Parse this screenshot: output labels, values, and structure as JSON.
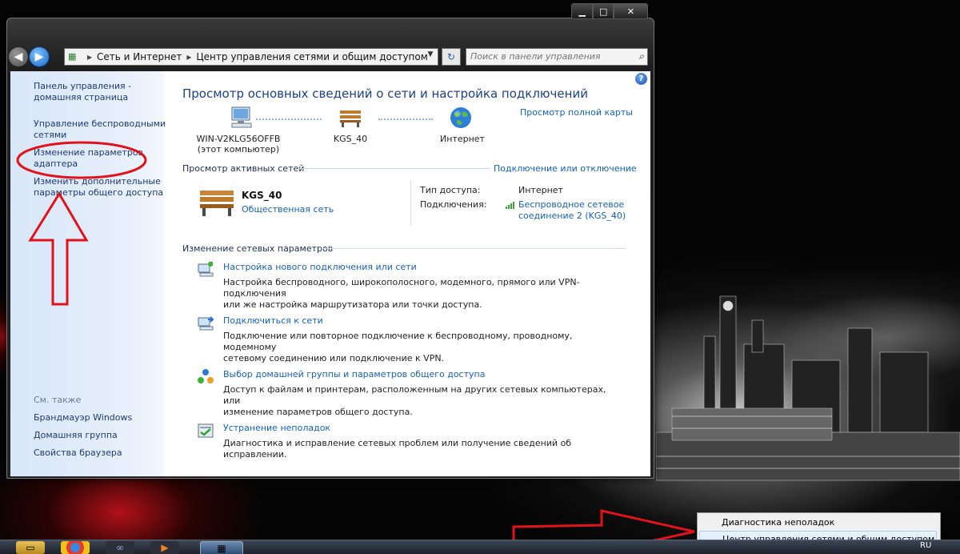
{
  "window": {
    "breadcrumb": [
      "Сеть и Интернет",
      "Центр управления сетями и общим доступом"
    ],
    "search_placeholder": "Поиск в панели управления"
  },
  "sidebar": {
    "links": [
      {
        "line1": "Панель управления -",
        "line2": "домашняя страница"
      },
      {
        "line1": "Управление беспроводными",
        "line2": "сетями"
      },
      {
        "line1": "Изменение параметров",
        "line2": "адаптера"
      },
      {
        "line1": "Изменить дополнительные",
        "line2": "параметры общего доступа"
      }
    ],
    "see_also_label": "См. также",
    "see_also": [
      "Брандмауэр Windows",
      "Домашняя группа",
      "Свойства браузера"
    ]
  },
  "main": {
    "title": "Просмотр основных сведений о сети и настройка подключений",
    "full_map_link": "Просмотр полной карты",
    "map": {
      "computer_name": "WIN-V2KLG56OFFB",
      "computer_sub": "(этот компьютер)",
      "network_name": "KGS_40",
      "internet_label": "Интернет"
    },
    "active_networks": {
      "heading": "Просмотр активных сетей",
      "connect_link": "Подключение или отключение",
      "network_name": "KGS_40",
      "network_type": "Общественная сеть",
      "access_type_label": "Тип доступа:",
      "access_type_value": "Интернет",
      "connections_label": "Подключения:",
      "connection_line1": "Беспроводное сетевое",
      "connection_line2": "соединение 2 (KGS_40)"
    },
    "change_settings": {
      "heading": "Изменение сетевых параметров",
      "tasks": [
        {
          "title": "Настройка нового подключения или сети",
          "desc1": "Настройка беспроводного, широкополосного, модемного, прямого или VPN-подключения",
          "desc2": "или же настройка маршрутизатора или точки доступа."
        },
        {
          "title": "Подключиться к сети",
          "desc1": "Подключение или повторное подключение к беспроводному, проводному, модемному",
          "desc2": "сетевому соединению или подключение к VPN."
        },
        {
          "title": "Выбор домашней группы и параметров общего доступа",
          "desc1": "Доступ к файлам и принтерам, расположенным на других сетевых компьютерах, или",
          "desc2": "изменение параметров общего доступа."
        },
        {
          "title": "Устранение неполадок",
          "desc1": "Диагностика и исправление сетевых проблем или получение сведений об исправлении.",
          "desc2": ""
        }
      ]
    }
  },
  "context_menu": {
    "items": [
      "Диагностика неполадок",
      "Центр управления сетями и общим доступом"
    ]
  },
  "taskbar": {
    "tray_lang": "RU"
  },
  "colors": {
    "annotation": "#e0131c",
    "link": "#1461b8",
    "title": "#1e3f87"
  }
}
